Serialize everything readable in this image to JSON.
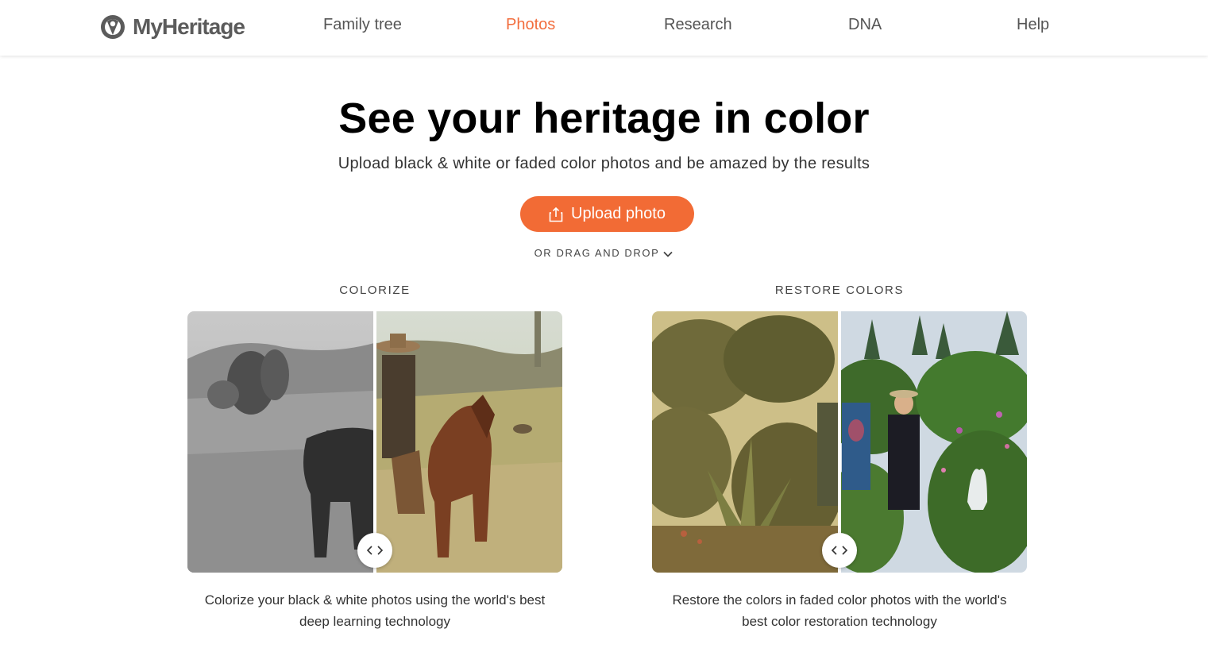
{
  "header": {
    "logo_text": "MyHeritage",
    "nav": [
      {
        "label": "Family tree",
        "active": false
      },
      {
        "label": "Photos",
        "active": true
      },
      {
        "label": "Research",
        "active": false
      },
      {
        "label": "DNA",
        "active": false
      },
      {
        "label": "Help",
        "active": false
      }
    ]
  },
  "hero": {
    "title": "See your heritage in color",
    "subtitle": "Upload black & white or faded color photos and be amazed by the results",
    "upload_label": "Upload photo",
    "drag_drop_label": "OR DRAG AND DROP"
  },
  "features": {
    "colorize": {
      "label": "COLORIZE",
      "description_line1": "Colorize your black & white photos using the world's best",
      "description_line2": "deep learning technology"
    },
    "restore": {
      "label": "RESTORE COLORS",
      "description_line1": "Restore the colors in faded color photos with the world's",
      "description_line2": "best color restoration technology"
    }
  },
  "colors": {
    "accent": "#f26b35",
    "nav_active": "#f26d3d",
    "text": "#333333"
  }
}
